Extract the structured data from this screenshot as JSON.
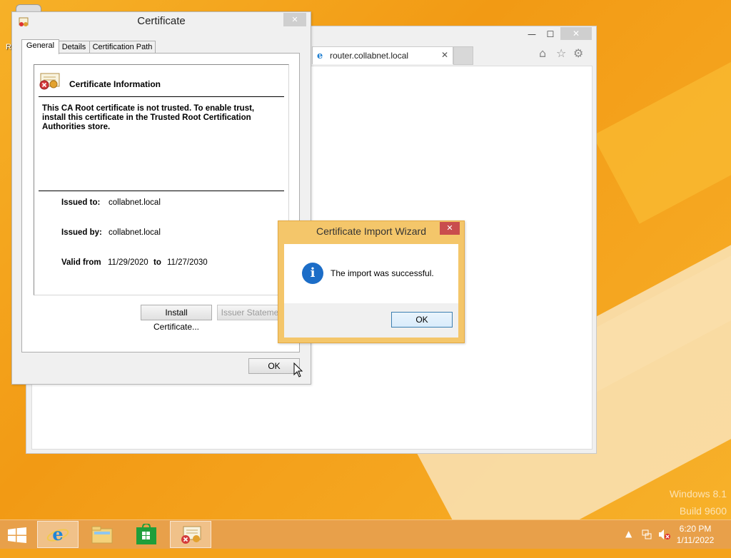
{
  "desktop": {
    "partial_label": "R",
    "watermark_line1": "Windows 8.1",
    "watermark_line2": "Build 9600"
  },
  "browser": {
    "tab_label": "router.collabnet.local",
    "tab_close": "✕",
    "minimize": "—",
    "maximize": "☐",
    "close": "✕",
    "home_icon": "⌂",
    "favorites_icon": "☆",
    "settings_icon": "⚙"
  },
  "certificate": {
    "title": "Certificate",
    "close": "✕",
    "tabs": [
      "General",
      "Details",
      "Certification Path"
    ],
    "info_heading": "Certificate Information",
    "description": "This CA Root certificate is not trusted. To enable trust, install this certificate in the Trusted Root Certification Authorities store.",
    "issued_to_label": "Issued to:",
    "issued_to_value": "collabnet.local",
    "issued_by_label": "Issued by:",
    "issued_by_value": "collabnet.local",
    "valid_from_label": "Valid from",
    "valid_from_value": "11/29/2020",
    "valid_to_label": "to",
    "valid_to_value": "11/27/2030",
    "install_button": "Install Certificate...",
    "issuer_button": "Issuer Statement",
    "ok_button": "OK"
  },
  "wizard": {
    "title": "Certificate Import Wizard",
    "close": "✕",
    "icon": "i",
    "message": "The import was successful.",
    "ok_button": "OK"
  },
  "taskbar": {
    "time": "6:20 PM",
    "date": "1/11/2022",
    "items": [
      "start-button",
      "internet-explorer",
      "file-explorer",
      "store",
      "certificate"
    ],
    "tray_up": "▲"
  }
}
